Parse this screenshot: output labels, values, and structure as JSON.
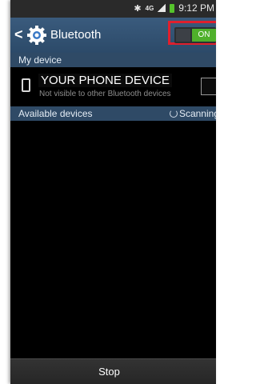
{
  "status_bar": {
    "bluetooth_icon": "bluetooth-icon",
    "network_label": "4G",
    "time": "9:12 PM"
  },
  "action_bar": {
    "title": "Bluetooth",
    "toggle_label": "ON",
    "toggle_state": "on"
  },
  "my_device_section": {
    "header": "My device",
    "device_name": "YOUR PHONE DEVICE",
    "visibility_text": "Not visible to other Bluetooth devices",
    "visible_checked": false
  },
  "available_section": {
    "header": "Available devices",
    "status": "Scanning..."
  },
  "bottom_bar": {
    "button_label": "Stop"
  },
  "colors": {
    "action_bar": "#35567a",
    "section_header": "#2f4a66",
    "toggle_on": "#4fb02b",
    "highlight_box": "#e01f2d"
  }
}
